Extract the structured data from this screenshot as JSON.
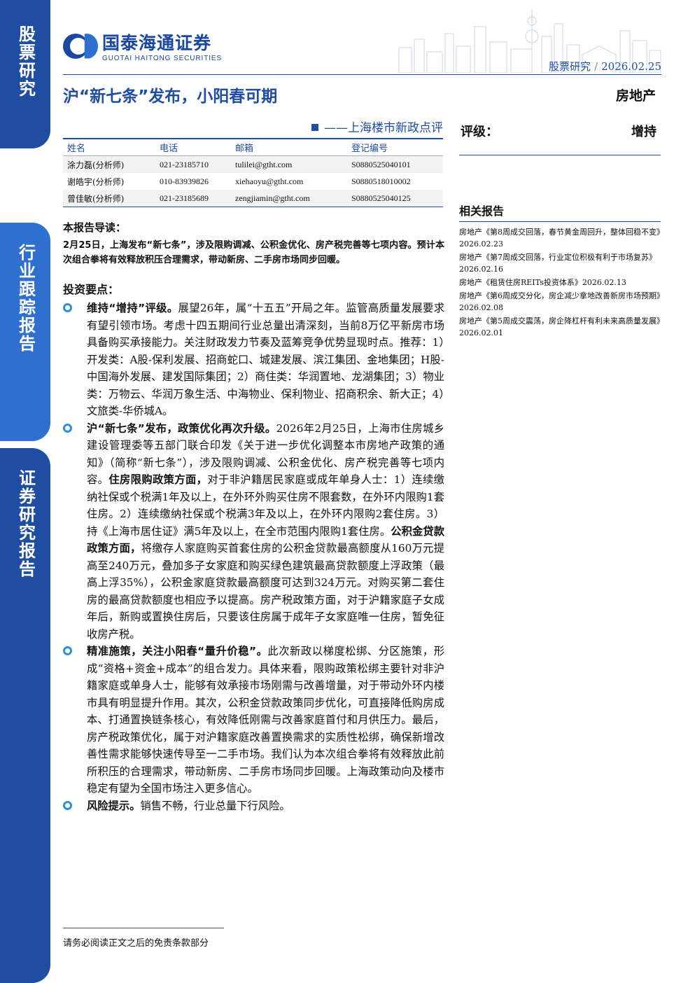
{
  "side_tabs": [
    "股票研究",
    "行业跟踪报告",
    "证券研究报告"
  ],
  "header": {
    "brand_cn": "国泰海通证券",
    "brand_en": "GUOTAI HAITONG SECURITIES",
    "category": "股票研究",
    "date": "2026.02.25",
    "accent_color": "#1e4da2"
  },
  "title": "沪“新七条”发布，小阳春可期",
  "industry": "房地产",
  "subtitle": "——上海楼市新政点评",
  "rating": {
    "label": "评级：",
    "value": "增持"
  },
  "analysts": {
    "headers": [
      "姓名",
      "电话",
      "邮箱",
      "登记编号"
    ],
    "rows": [
      [
        "涂力磊(分析师)",
        "021-23185710",
        "tulilei@gtht.com",
        "S0880525040101"
      ],
      [
        "谢皓宇(分析师)",
        "010-83939826",
        "xiehaoyu@gtht.com",
        "S0880518010002"
      ],
      [
        "曾佳敏(分析师)",
        "021-23185689",
        "zengjiamin@gtht.com",
        "S0880525040125"
      ]
    ]
  },
  "related": {
    "title": "相关报告",
    "items": [
      "房地产《第8周成交回落，春节黄金周回升，整体回稳不变》2026.02.23",
      "房地产《第7周成交回落，行业定位积极有利于市场复苏》2026.02.16",
      "房地产《租赁住房REITs投资体系》2026.02.13",
      "房地产《第6周成交分化，房企减少拿地改善新房市场预期》2026.02.08",
      "房地产《第5周成交震荡，房企降杠杆有利未来高质量发展》2026.02.01"
    ]
  },
  "guide": {
    "heading": "本报告导读：",
    "body": "2月25日，上海发布“新七条”，涉及限购调减、公积金优化、房产税完善等七项内容。预计本次组合拳将有效释放积压合理需求，带动新房、二手房市场同步回暖。"
  },
  "points": {
    "heading": "投资要点：",
    "items": [
      {
        "lead": "维持“增持”评级。",
        "text": "展望26年，属“十五五”开局之年。监管高质量发展要求有望引领市场。考虑十四五期间行业总量出清深刻，当前8万亿平新房市场具备购买承接能力。关注财政发力节奏及蓝筹竞争优势显现时点。推荐：1）开发类：A股-保利发展、招商蛇口、城建发展、滨江集团、金地集团；H股-中国海外发展、建发国际集团；2）商住类：华润置地、龙湖集团；3）物业类：万物云、华润万象生活、中海物业、保利物业、招商积余、新大正；4）文旅类-华侨城A。"
      },
      {
        "lead": "沪“新七条”发布，政策优化再次升级。",
        "text1": "2026年2月25日，上海市住房城乡建设管理委等五部门联合印发《关于进一步优化调整本市房地产政策的通知》（简称“新七条”），涉及限购调减、公积金优化、房产税完善等七项内容。",
        "em1": "住房限购政策方面，",
        "text2": "对于非沪籍居民家庭或成年单身人士：1）连续缴纳社保或个税满1年及以上，在外环外购买住房不限套数，在外环内限购1套住房。2）连续缴纳社保或个税满3年及以上，在外环内限购2套住房。3）持《上海市居住证》满5年及以上，在全市范围内限购1套住房。",
        "em2": "公积金贷款政策方面，",
        "text3": "将缴存人家庭购买首套住房的公积金贷款最高额度从160万元提高至240万元，叠加多子女家庭和购买绿色建筑最高贷款额度上浮政策（最高上浮35%），公积金家庭贷款最高额度可达到324万元。对购买第二套住房的最高贷款额度也相应予以提高。房产税政策方面，对于沪籍家庭子女成年后，新购或置换住房后，只要该住房属于成年子女家庭唯一住房，暂免征收房产税。"
      },
      {
        "lead": "精准施策，关注小阳春“量升价稳”。",
        "text": "此次新政以梯度松绑、分区施策，形成“资格+资金+成本”的组合发力。具体来看，限购政策松绑主要针对非沪籍家庭或单身人士，能够有效承接市场刚需与改善增量，对于带动外环内楼市具有明显提升作用。其次，公积金贷款政策同步优化，可直接降低购房成本、打通置换链条核心，有效降低刚需与改善家庭首付和月供压力。最后，房产税政策优化，属于对沪籍家庭改善置换需求的实质性松绑，确保新增改善性需求能够快速传导至一二手市场。我们认为本次组合拳将有效释放此前所积压的合理需求，带动新房、二手房市场同步回暖。上海政策动向及楼市稳定有望为全国市场注入更多信心。"
      },
      {
        "lead": "风险提示。",
        "text": "销售不畅，行业总量下行风险。"
      }
    ]
  },
  "footer": "请务必阅读正文之后的免责条款部分"
}
